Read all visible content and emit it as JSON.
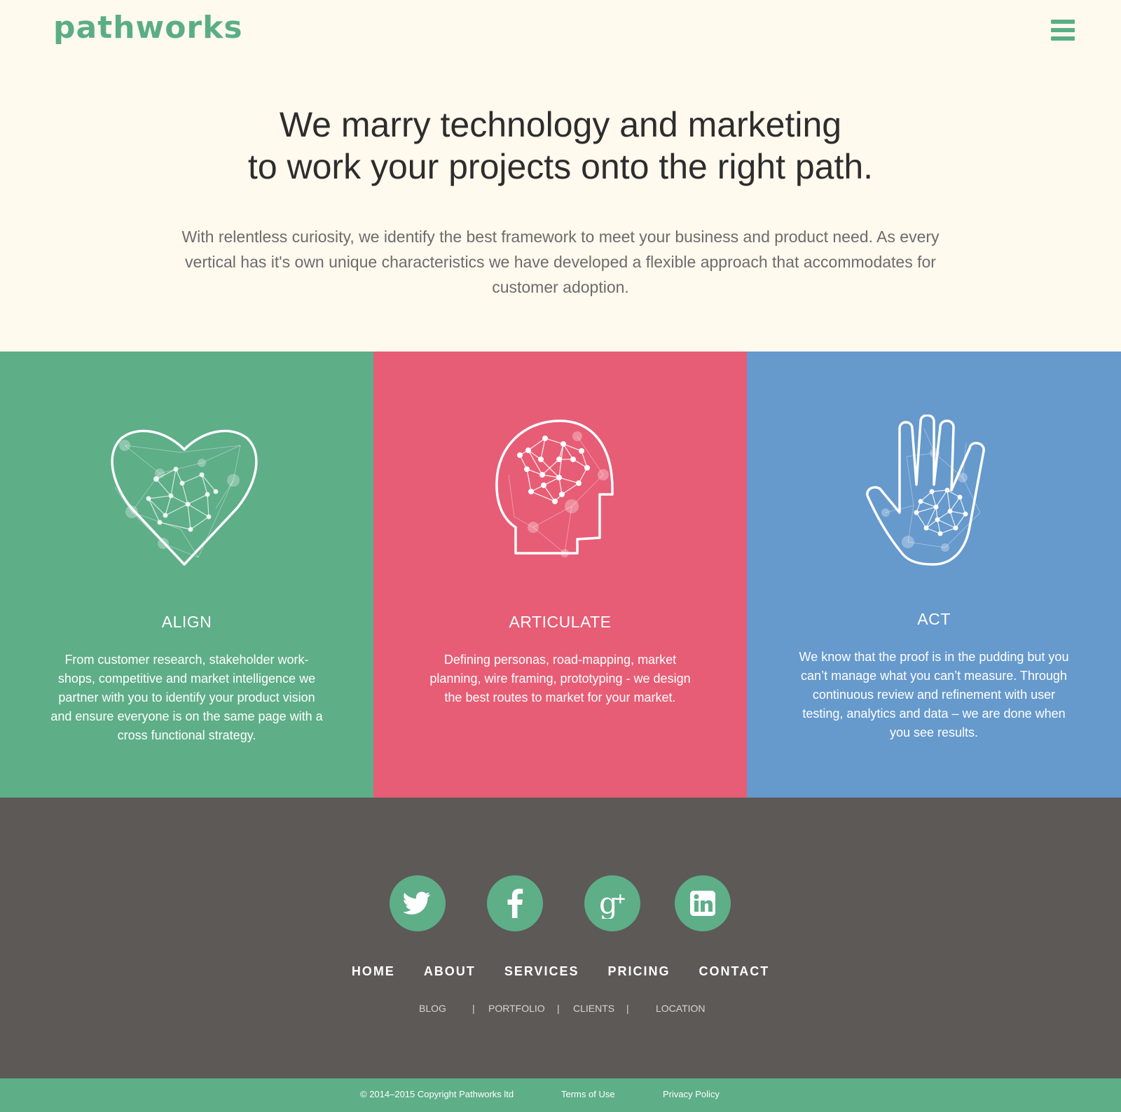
{
  "header": {
    "logo": "pathworks",
    "menu_icon": "hamburger-menu-icon"
  },
  "hero": {
    "title_line1": "We marry technology and marketing",
    "title_line2": "to work your projects onto the right path.",
    "body": "With relentless curiosity, we identify the best framework to meet your business  and product need. As every vertical has it's own unique characteristics we have developed a flexible approach that accommodates for customer adoption."
  },
  "panels": [
    {
      "title": "ALIGN",
      "text": "From customer research, stakeholder work-shops, competitive and market intelligence we partner with you to identify your product vision and ensure everyone is on the same page with a cross functional strategy.",
      "icon": "heart-network-icon",
      "color": "#5eae88"
    },
    {
      "title": "ARTICULATE",
      "text": "Defining personas, road-mapping, market planning, wire framing, prototyping - we design the best routes to market for your market.",
      "icon": "head-network-icon",
      "color": "#e75d75"
    },
    {
      "title": "ACT",
      "text": "We know that the proof is in the pudding but you can’t manage what you can’t measure.  Through continuous review and refinement with user testing, analytics and data – we are done when you see results.",
      "icon": "hand-network-icon",
      "color": "#6699cc"
    }
  ],
  "social": [
    {
      "name": "twitter",
      "icon": "twitter-icon"
    },
    {
      "name": "facebook",
      "icon": "facebook-icon"
    },
    {
      "name": "google-plus",
      "icon": "google-plus-icon"
    },
    {
      "name": "linkedin",
      "icon": "linkedin-icon"
    }
  ],
  "nav_main": [
    "HOME",
    "ABOUT",
    "SERVICES",
    "PRICING",
    "CONTACT"
  ],
  "nav_sub": {
    "items": [
      "BLOG",
      "PORTFOLIO",
      "CLIENTS",
      "LOCATION"
    ],
    "separator": "|"
  },
  "footer": {
    "copyright": "© 2014–2015 Copyright Pathworks ltd",
    "terms": "Terms of Use",
    "privacy": "Privacy Policy"
  },
  "colors": {
    "accent": "#5eae88",
    "red": "#e75d75",
    "blue": "#6699cc",
    "dark": "#5c5957",
    "cream": "#fff9ee"
  }
}
